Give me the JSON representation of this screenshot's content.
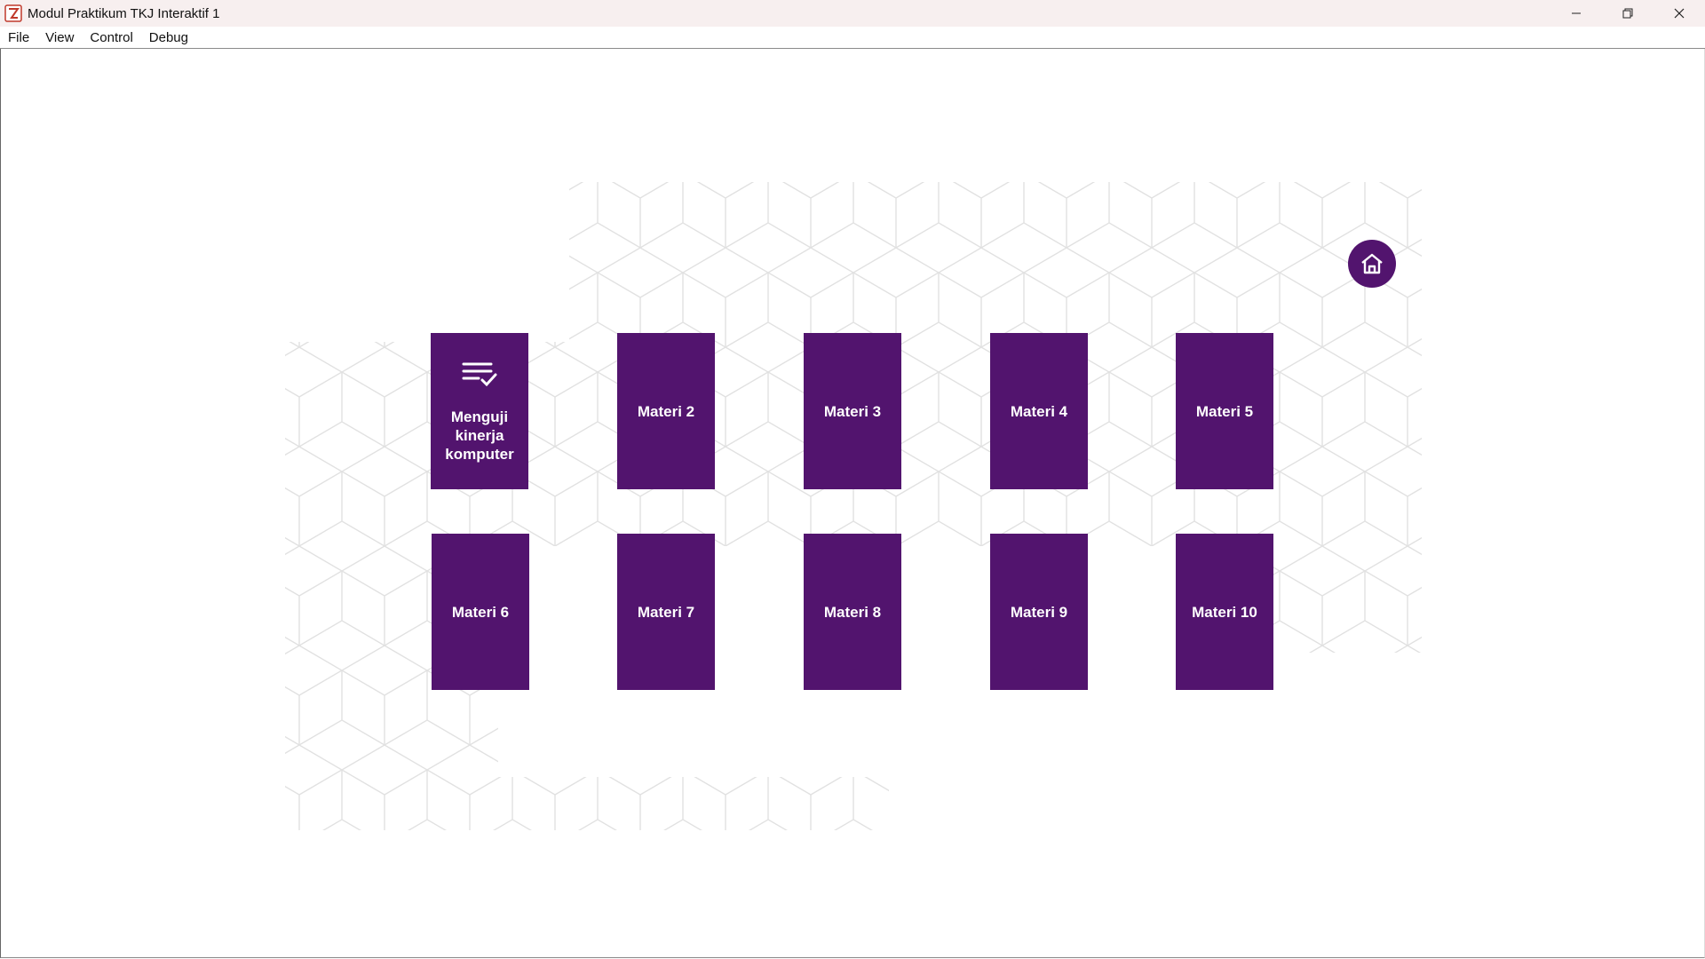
{
  "window": {
    "title": "Modul Praktikum TKJ Interaktif 1"
  },
  "menu": [
    "File",
    "View",
    "Control",
    "Debug"
  ],
  "colors": {
    "tile": "#52146e",
    "pattern": "#dcdcdc"
  },
  "tiles": [
    {
      "label": "Menguji kinerja komputer",
      "icon": "checklist-icon"
    },
    {
      "label": "Materi 2"
    },
    {
      "label": "Materi 3"
    },
    {
      "label": "Materi 4"
    },
    {
      "label": "Materi 5"
    },
    {
      "label": "Materi 6"
    },
    {
      "label": "Materi 7"
    },
    {
      "label": "Materi 8"
    },
    {
      "label": "Materi 9"
    },
    {
      "label": "Materi 10"
    }
  ],
  "home_button": {
    "icon": "home-icon"
  }
}
